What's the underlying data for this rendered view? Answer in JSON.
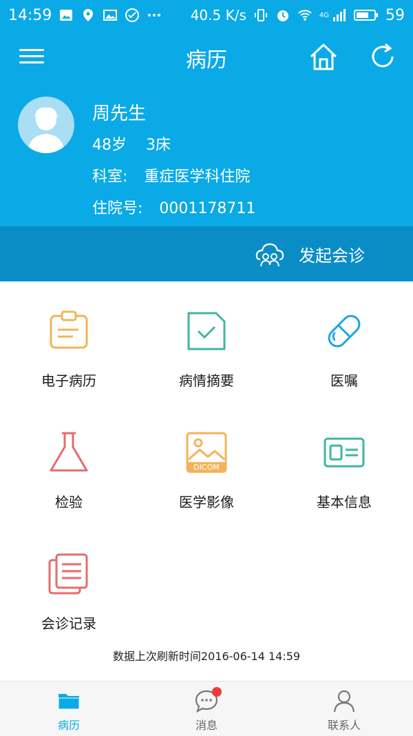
{
  "status_bar": {
    "time": "14:59",
    "speed": "40.5 K/s",
    "network": "4G",
    "battery": "59",
    "icons": [
      "photo-icon",
      "location-icon",
      "image-icon",
      "check-circle-icon",
      "more-dots-icon",
      "vibrate-icon",
      "alarm-icon",
      "wifi-icon",
      "signal-icon",
      "battery-icon"
    ]
  },
  "header": {
    "title": "病历",
    "menu_icon": "menu-icon",
    "home_icon": "home-icon",
    "refresh_icon": "refresh-icon",
    "background": "#0aaae6"
  },
  "patient": {
    "name": "周先生",
    "age": "48岁",
    "bed": "3床",
    "dept_label": "科室:",
    "dept_value": "重症医学科住院",
    "admission_label": "住院号:",
    "admission_value": "0001178711",
    "avatar_icon": "avatar-icon"
  },
  "consult": {
    "label": "发起会诊",
    "icon": "group-cloud-icon",
    "background": "#0a8dc7"
  },
  "modules": [
    {
      "label": "电子病历",
      "icon": "clipboard-icon",
      "color": "#f3b35a"
    },
    {
      "label": "病情摘要",
      "icon": "document-check-icon",
      "color": "#3fb6a0"
    },
    {
      "label": "医嘱",
      "icon": "pill-icon",
      "color": "#1aa8e0"
    },
    {
      "label": "检验",
      "icon": "flask-icon",
      "color": "#e76b6b"
    },
    {
      "label": "医学影像",
      "icon": "image-dicom-icon",
      "color": "#f3b35a",
      "tag": "DICOM"
    },
    {
      "label": "基本信息",
      "icon": "id-card-icon",
      "color": "#3fb6a0"
    },
    {
      "label": "会诊记录",
      "icon": "stacked-docs-icon",
      "color": "#e76b6b"
    }
  ],
  "refresh_time": "数据上次刷新时间2016-06-14 14:59",
  "tabs": [
    {
      "label": "病历",
      "icon": "folder-icon",
      "active": true
    },
    {
      "label": "消息",
      "icon": "chat-bubble-icon",
      "active": false,
      "badge": true
    },
    {
      "label": "联系人",
      "icon": "person-icon",
      "active": false
    }
  ]
}
